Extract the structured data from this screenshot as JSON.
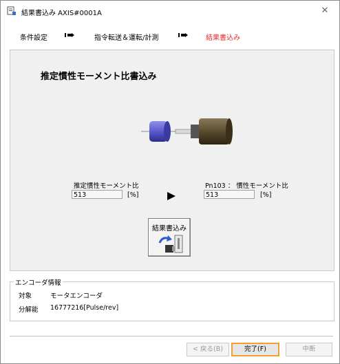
{
  "window": {
    "title": "結果書込み AXIS#0001A",
    "close_glyph": "✕"
  },
  "steps": [
    {
      "label": "条件設定",
      "active": false
    },
    {
      "label": "指令転送＆運転/計測",
      "active": false
    },
    {
      "label": "結果書込み",
      "active": true
    }
  ],
  "colors": {
    "active_step": "#e8272a",
    "accent_button": "#f0a030"
  },
  "main": {
    "heading": "推定慣性モーメント比書込み",
    "estimated": {
      "label": "推定慣性モーメント比",
      "value": "513",
      "unit": "[%]"
    },
    "target": {
      "label": "Pn103 ： 慣性モーメント比",
      "value": "513",
      "unit": "[%]"
    },
    "write_button_label": "結果書込み"
  },
  "encoder": {
    "group_title": "エンコーダ情報",
    "target_key": "対象",
    "target_value": "モータエンコーダ",
    "resolution_key": "分解能",
    "resolution_value": "16777216[Pulse/rev]"
  },
  "footer": {
    "back_label": "< 戻る(B)",
    "finish_label": "完了(F)",
    "abort_label": "中断"
  }
}
